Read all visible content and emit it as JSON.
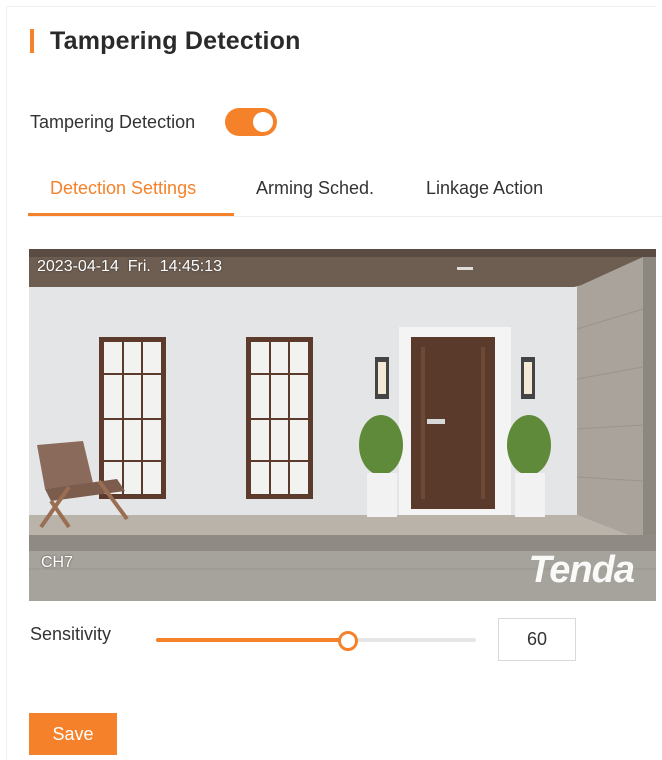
{
  "header": {
    "title": "Tampering Detection"
  },
  "toggle": {
    "label": "Tampering Detection",
    "enabled": true
  },
  "tabs": [
    {
      "label": "Detection Settings",
      "active": true
    },
    {
      "label": "Arming Sched.",
      "active": false
    },
    {
      "label": "Linkage Action",
      "active": false
    }
  ],
  "preview": {
    "timestamp": "2023-04-14  Fri.  14:45:13",
    "channel": "CH7",
    "brand": "Tenda"
  },
  "sensitivity": {
    "label": "Sensitivity",
    "value": "60",
    "min": 0,
    "max": 100
  },
  "actions": {
    "save_label": "Save"
  },
  "colors": {
    "accent": "#f5822a"
  }
}
